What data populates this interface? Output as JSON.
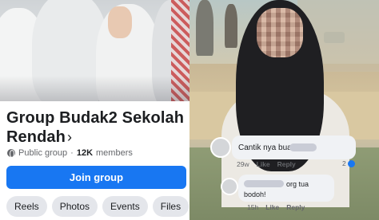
{
  "left": {
    "group_title": "Group Budak2 Sekolah Rendah",
    "chevron": "›",
    "privacy": "Public group",
    "separator": "·",
    "member_count": "12K",
    "members_label": "members",
    "join_label": "Join group",
    "tabs": [
      "Reels",
      "Photos",
      "Events",
      "Files"
    ],
    "accent_color": "#1877f2"
  },
  "comments": [
    {
      "text": "Cantik nya buah",
      "time": "29w",
      "like": "Like",
      "reply": "Reply",
      "reaction_count": "2"
    },
    {
      "line1": "org tua",
      "line2": "bodoh!",
      "time": "15h",
      "like": "Like",
      "reply": "Reply"
    }
  ]
}
